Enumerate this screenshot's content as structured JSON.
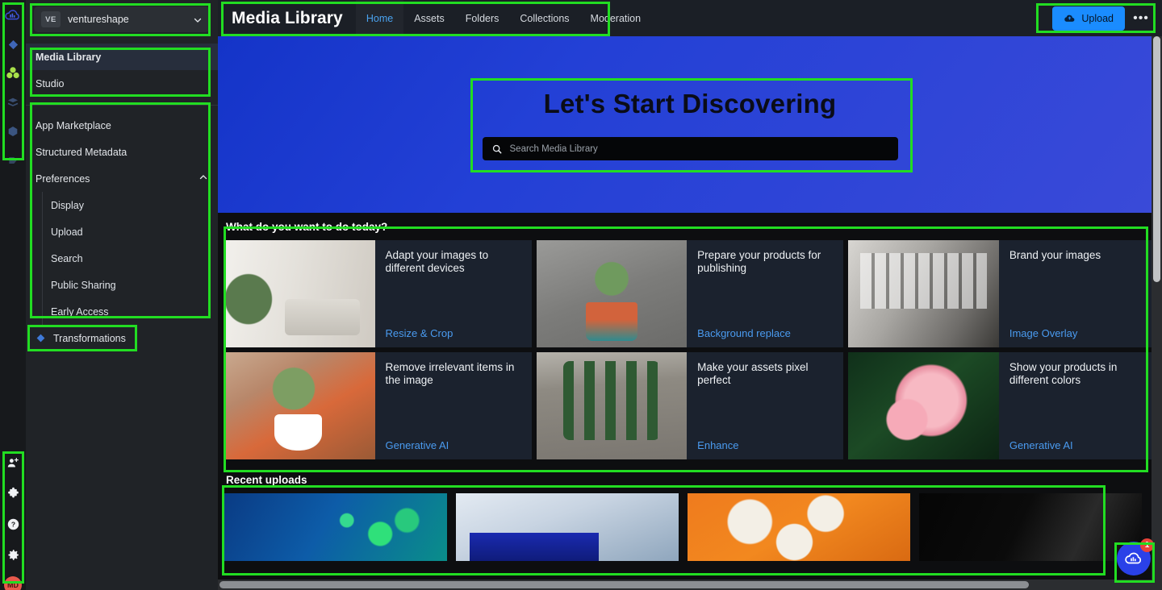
{
  "icon_rail": {
    "top_icons": [
      "cloud-logo-icon",
      "diamond-icon",
      "clover-icon",
      "stack-icon",
      "hexagon-icon",
      "shape-icon"
    ],
    "bottom_icons": [
      "add-user-icon",
      "puzzle-icon",
      "help-circle-icon",
      "gear-icon"
    ],
    "avatar_initials": "MD"
  },
  "sidebar": {
    "org": {
      "badge": "VE",
      "name": "ventureshape",
      "chevron": "chevron-down-icon"
    },
    "primary": [
      {
        "label": "Media Library",
        "active": true
      },
      {
        "label": "Studio",
        "active": false
      }
    ],
    "secondary": [
      {
        "label": "App Marketplace"
      },
      {
        "label": "Structured Metadata"
      }
    ],
    "preferences": {
      "label": "Preferences",
      "chevron": "chevron-up-icon",
      "expanded": true,
      "items": [
        {
          "label": "Display"
        },
        {
          "label": "Upload"
        },
        {
          "label": "Search"
        },
        {
          "label": "Public Sharing"
        },
        {
          "label": "Early Access"
        }
      ]
    },
    "transformations": {
      "label": "Transformations",
      "icon": "diamond-icon"
    }
  },
  "header": {
    "title": "Media Library",
    "tabs": [
      {
        "label": "Home",
        "active": true
      },
      {
        "label": "Assets",
        "active": false
      },
      {
        "label": "Folders",
        "active": false
      },
      {
        "label": "Collections",
        "active": false
      },
      {
        "label": "Moderation",
        "active": false
      }
    ],
    "upload_label": "Upload",
    "upload_icon": "cloud-upload-icon",
    "more_label": "•••",
    "more_icon": "more-horizontal-icon"
  },
  "hero": {
    "title": "Let's Start Discovering",
    "search_placeholder": "Search Media Library",
    "search_value": "",
    "search_icon": "search-icon"
  },
  "actions_section": {
    "title": "What do you want to do today?",
    "cards": [
      {
        "heading": "Adapt your images to different devices",
        "link": "Resize & Crop",
        "image": "ph-living"
      },
      {
        "heading": "Prepare your products for publishing",
        "link": "Background replace",
        "image": "ph-succ"
      },
      {
        "heading": "Brand your images",
        "link": "Image Overlay",
        "image": "ph-loft"
      },
      {
        "heading": "Remove irrelevant items in the image",
        "link": "Generative AI",
        "image": "ph-pot"
      },
      {
        "heading": "Make your assets pixel perfect",
        "link": "Enhance",
        "image": "ph-cactus"
      },
      {
        "heading": "Show your products in different colors",
        "link": "Generative AI",
        "image": "ph-rose"
      }
    ]
  },
  "recent_section": {
    "title": "Recent uploads",
    "thumbnails": [
      {
        "image": "ph-pipette"
      },
      {
        "image": "ph-lab"
      },
      {
        "image": "ph-petri"
      },
      {
        "image": "ph-dark"
      }
    ]
  },
  "help_widget": {
    "icon": "cloud-logo-icon",
    "badge": "1"
  },
  "colors": {
    "accent_blue": "#1a8cff",
    "link_blue": "#4a9bf0",
    "tab_active": "#4aa3f0",
    "tab_underline": "#3ddbc8",
    "hero_start": "#1434c8",
    "hero_end": "#3a4ad8",
    "sidebar_bg": "#202327",
    "rail_bg": "#17191c",
    "card_bg": "#1b222e",
    "badge_red": "#e8433a",
    "avatar_red": "#e8594c",
    "highlight_green": "#22dd22"
  }
}
